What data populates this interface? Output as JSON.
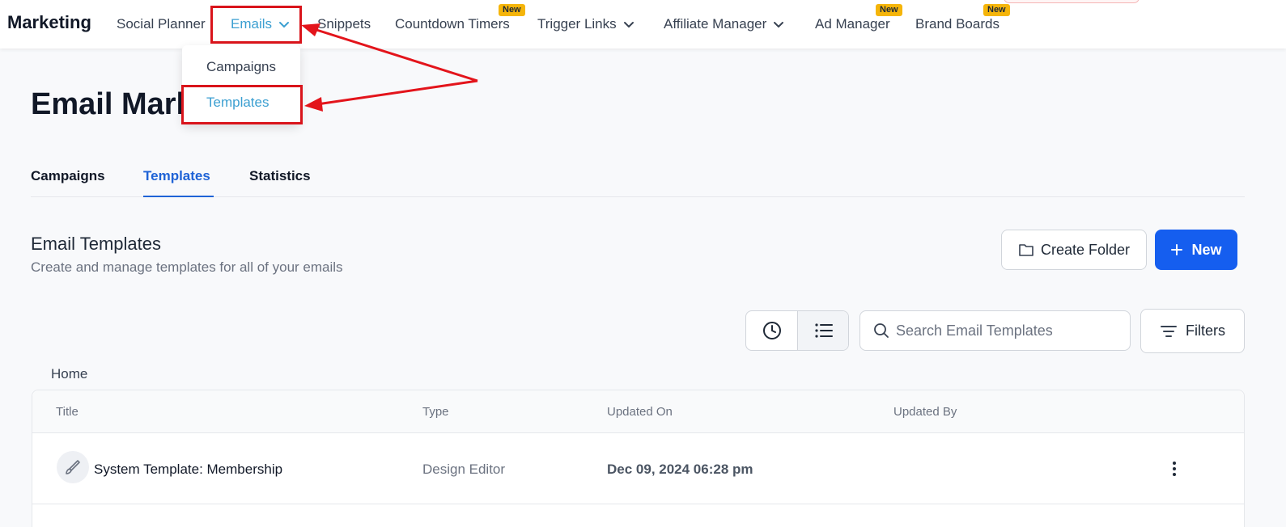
{
  "nav": {
    "brand": "Marketing",
    "items": [
      {
        "label": "Social Planner"
      },
      {
        "label": "Emails"
      },
      {
        "label": "Snippets"
      },
      {
        "label": "Countdown Timers",
        "badge": "New"
      },
      {
        "label": "Trigger Links"
      },
      {
        "label": "Affiliate Manager"
      },
      {
        "label": "Ad Manager",
        "badge": "New"
      },
      {
        "label": "Brand Boards",
        "badge": "New"
      }
    ]
  },
  "dropdown": {
    "items": [
      {
        "label": "Campaigns"
      },
      {
        "label": "Templates"
      }
    ]
  },
  "page": {
    "title": "Email Mark"
  },
  "tabs": [
    {
      "label": "Campaigns"
    },
    {
      "label": "Templates"
    },
    {
      "label": "Statistics"
    }
  ],
  "section": {
    "title": "Email Templates",
    "subtitle": "Create and manage templates for all of your emails",
    "create_folder_label": "Create Folder",
    "new_label": "New"
  },
  "toolbar": {
    "search_placeholder": "Search Email Templates",
    "filters_label": "Filters"
  },
  "breadcrumb": "Home",
  "table": {
    "columns": [
      "Title",
      "Type",
      "Updated On",
      "Updated By"
    ],
    "rows": [
      {
        "title": "System Template: Membership",
        "type": "Design Editor",
        "updated_on": "Dec 09, 2024 06:28 pm",
        "updated_by": ""
      }
    ]
  },
  "colors": {
    "accent": "#155eef",
    "active_nav": "#3b9fd1",
    "highlight": "#d9141b",
    "badge": "#f5b50a"
  }
}
